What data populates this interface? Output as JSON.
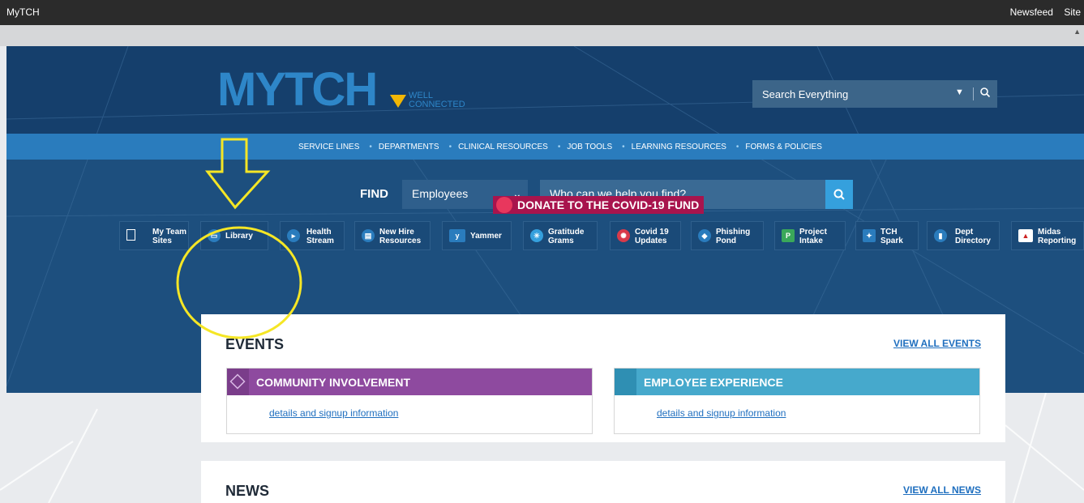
{
  "topbar": {
    "app_title": "MyTCH",
    "links": [
      "Newsfeed",
      "Site"
    ]
  },
  "logo": {
    "main": "MYTCH",
    "tag_line1": "WELL",
    "tag_line2": "CONNECTED"
  },
  "search": {
    "label": "Search Everything"
  },
  "nav": [
    "SERVICE LINES",
    "DEPARTMENTS",
    "CLINICAL RESOURCES",
    "JOB TOOLS",
    "LEARNING RESOURCES",
    "FORMS & POLICIES"
  ],
  "find": {
    "label": "FIND",
    "select_value": "Employees",
    "placeholder": "Who can we help you find?"
  },
  "donate": {
    "label": "DONATE TO THE COVID-19 FUND"
  },
  "tiles": [
    {
      "line1": "My Team",
      "line2": "Sites",
      "icon": "page-icon"
    },
    {
      "line1": "Library",
      "line2": "",
      "icon": "library-icon"
    },
    {
      "line1": "Health",
      "line2": "Stream",
      "icon": "stream-icon"
    },
    {
      "line1": "New Hire",
      "line2": "Resources",
      "icon": "id-card-icon"
    },
    {
      "line1": "Yammer",
      "line2": "",
      "icon": "yammer-icon"
    },
    {
      "line1": "Gratitude",
      "line2": "Grams",
      "icon": "snowflake-icon"
    },
    {
      "line1": "Covid 19",
      "line2": "Updates",
      "icon": "virus-icon"
    },
    {
      "line1": "Phishing",
      "line2": "Pond",
      "icon": "phishing-icon"
    },
    {
      "line1": "Project",
      "line2": "Intake",
      "icon": "project-icon"
    },
    {
      "line1": "TCH",
      "line2": "Spark",
      "icon": "spark-icon"
    },
    {
      "line1": "Dept",
      "line2": "Directory",
      "icon": "directory-icon"
    },
    {
      "line1": "Midas",
      "line2": "Reporting",
      "icon": "midas-icon"
    }
  ],
  "events": {
    "title": "EVENTS",
    "view_all": "VIEW ALL EVENTS",
    "cards": [
      {
        "title": "COMMUNITY INVOLVEMENT",
        "link": "details and signup information",
        "color": "#8e4a9f"
      },
      {
        "title": "EMPLOYEE EXPERIENCE",
        "link": "details and signup information",
        "color": "#46a9cc"
      }
    ]
  },
  "news": {
    "title": "NEWS",
    "view_all": "VIEW ALL NEWS"
  },
  "colors": {
    "annotation": "#f5e625",
    "brand_blue": "#2e86c8"
  }
}
